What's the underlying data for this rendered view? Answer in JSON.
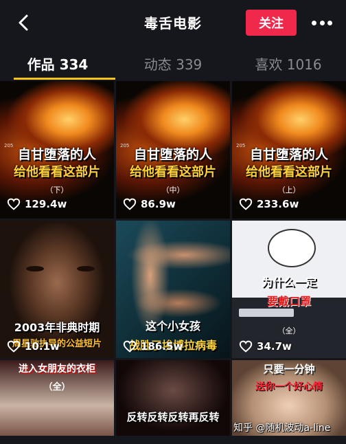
{
  "header": {
    "title": "毒舌电影",
    "follow_label": "关注",
    "back_icon": "chevron-left-icon",
    "more_icon": "more-dots-icon"
  },
  "tabs": [
    {
      "label": "作品 334",
      "active": true
    },
    {
      "label": "动态 339",
      "active": false
    },
    {
      "label": "喜欢 1016",
      "active": false
    }
  ],
  "colors": {
    "accent": "#f0284b",
    "tab_indicator": "#f5c518",
    "background": "#16171d"
  },
  "videos": [
    {
      "line1": "自甘堕落的人",
      "line2": "给他看看这部片",
      "part": "（下）",
      "tag": "205",
      "likes": "129.4w"
    },
    {
      "line1": "自甘堕落的人",
      "line2": "给他看看这部片",
      "part": "（中）",
      "tag": "205",
      "likes": "86.9w"
    },
    {
      "line1": "自甘堕落的人",
      "line2": "给他看看这部片",
      "part": "（上）",
      "tag": "205",
      "likes": "233.6w"
    },
    {
      "line1": "2003年非典时期",
      "line2": "周星驰执导的公益短片",
      "likes": "10.1w"
    },
    {
      "line1": "这个小女孩",
      "line2": "战胜了埃博拉病毒",
      "likes": "186.5w"
    },
    {
      "line1": "为什么一定",
      "line2": "要戴口罩",
      "part": "（全）",
      "likes": "34.7w"
    },
    {
      "line1": "进入女朋友的衣柜",
      "part": "（全）"
    },
    {
      "line1": "反转反转反转再反转"
    },
    {
      "line1": "只要一分钟",
      "line2": "送你一个好心情"
    }
  ],
  "watermark": "知乎 @随机波动a-line"
}
